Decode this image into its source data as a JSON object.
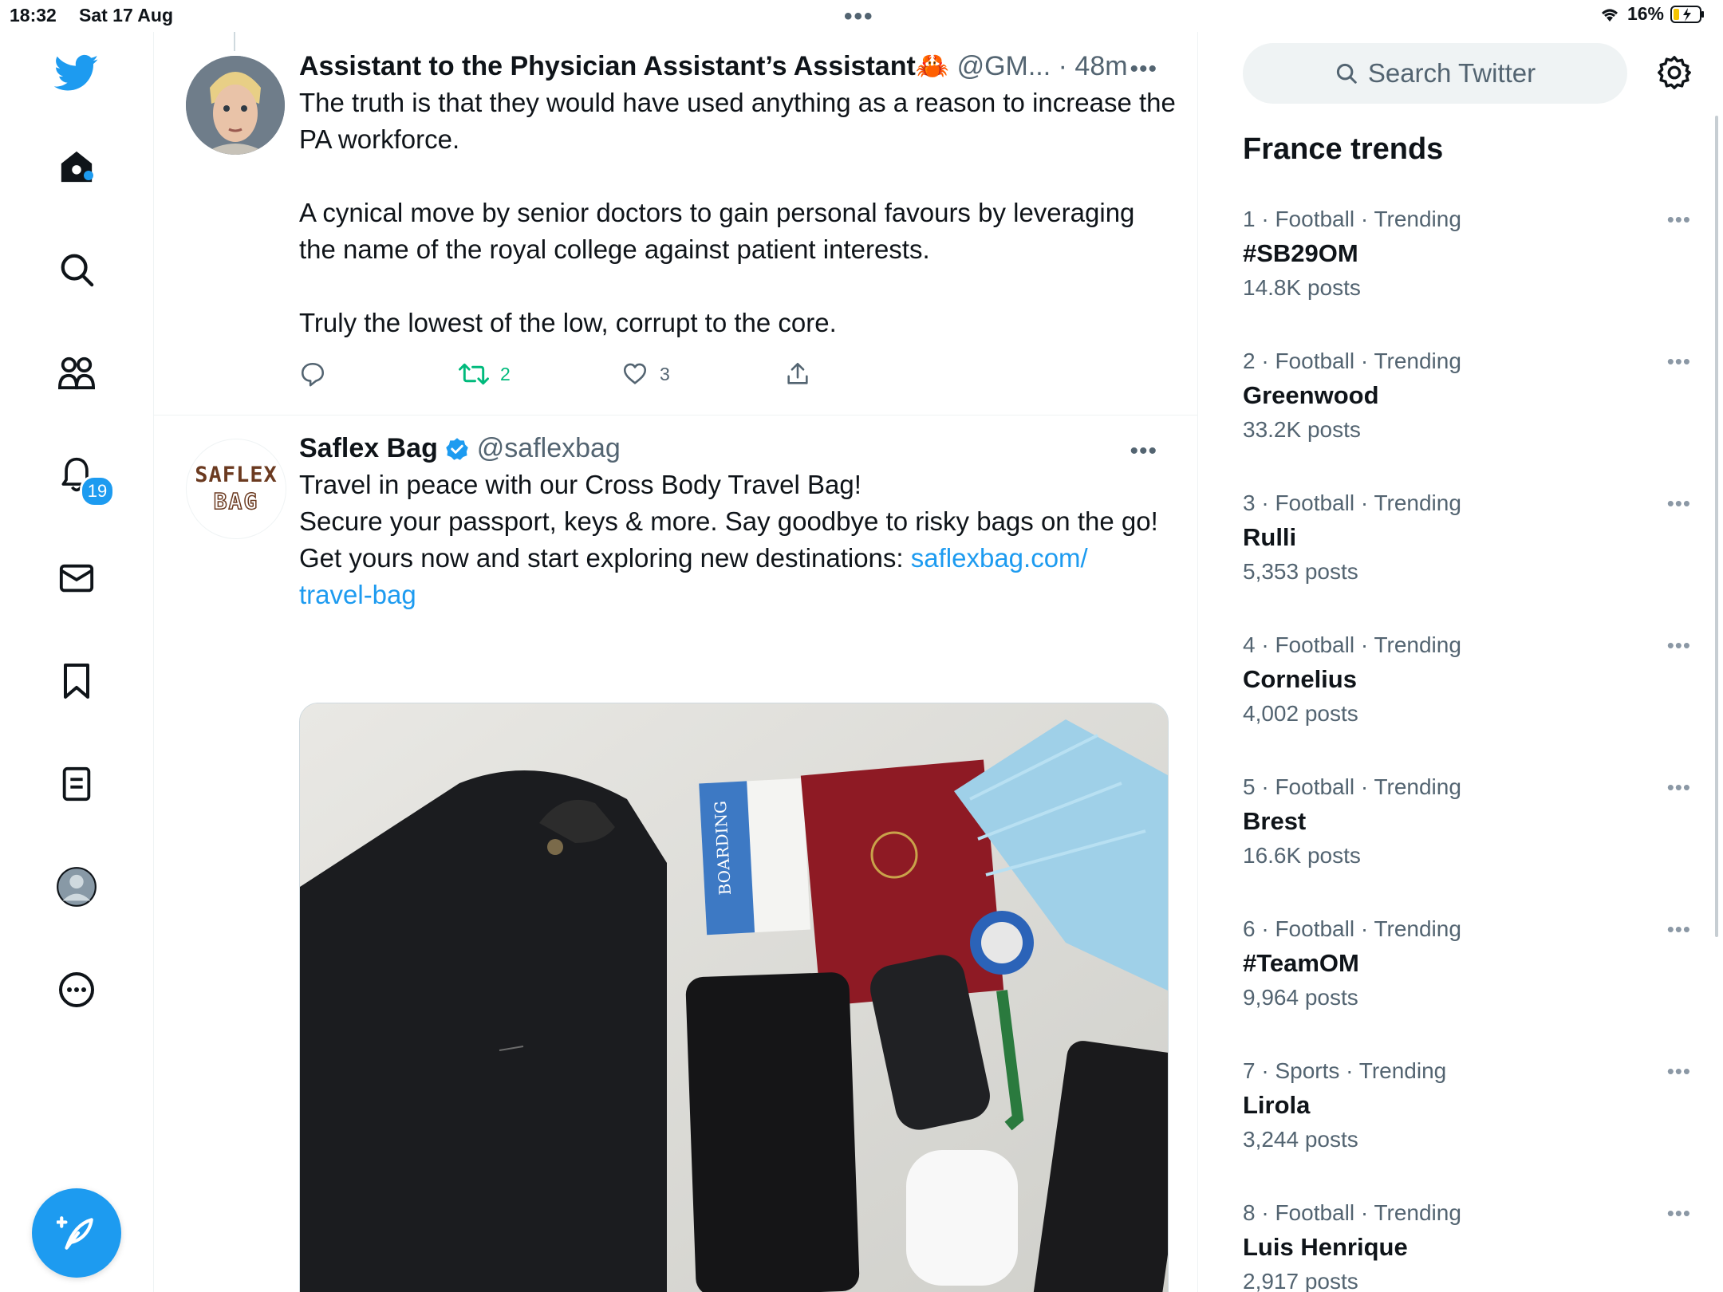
{
  "status_bar": {
    "time": "18:32",
    "date": "Sat 17 Aug",
    "battery": "16%"
  },
  "nav": {
    "notifications_count": "19"
  },
  "tweets": [
    {
      "name": "Assistant to the Physician Assistant’s Assistant🦀",
      "handle": "@GM...",
      "time": "· 48m",
      "text": "The truth is that they would have used anything as a reason to increase the PA workforce.\n\nA cynical move by senior doctors to gain personal favours by leveraging the name of the royal college against patient interests.\n\nTruly the lowest of the low, corrupt to the core.",
      "retweets": "2",
      "likes": "3"
    },
    {
      "name": "Saflex Bag",
      "handle": "@saflexbag",
      "avatar_text_1": "SAFLEX",
      "avatar_text_2": "BAG",
      "text": "Travel in peace with our Cross Body Travel Bag!\nSecure your passport, keys & more. Say goodbye to risky bags on the go!\nGet yours now and start exploring new destinations: ",
      "link": "saflexbag.com/\ntravel-bag",
      "media_label": "BOARDING"
    }
  ],
  "sidebar": {
    "search_placeholder": "Search Twitter",
    "trends_title": "France trends",
    "trends": [
      {
        "meta": "1 · Football · Trending",
        "topic": "#SB29OM",
        "posts": "14.8K posts"
      },
      {
        "meta": "2 · Football · Trending",
        "topic": "Greenwood",
        "posts": "33.2K posts"
      },
      {
        "meta": "3 · Football · Trending",
        "topic": "Rulli",
        "posts": "5,353 posts"
      },
      {
        "meta": "4 · Football · Trending",
        "topic": "Cornelius",
        "posts": "4,002 posts"
      },
      {
        "meta": "5 · Football · Trending",
        "topic": "Brest",
        "posts": "16.6K posts"
      },
      {
        "meta": "6 · Football · Trending",
        "topic": "#TeamOM",
        "posts": "9,964 posts"
      },
      {
        "meta": "7 · Sports · Trending",
        "topic": "Lirola",
        "posts": "3,244 posts"
      },
      {
        "meta": "8 · Football · Trending",
        "topic": "Luis Henrique",
        "posts": "2,917 posts"
      }
    ]
  },
  "colors": {
    "accent": "#1d9bf0",
    "retweet": "#00ba7c",
    "text": "#0f1419",
    "muted": "#536471"
  }
}
